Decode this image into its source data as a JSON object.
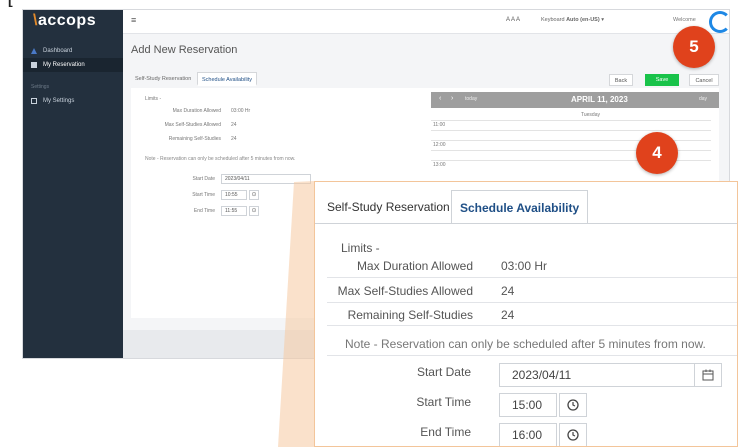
{
  "caption": "[",
  "app": {
    "logo": "accops",
    "topbar": {
      "menu_glyph": "≡",
      "font_controls": "A A A",
      "keyboard_label": "Keyboard",
      "keyboard_value": "Auto (en-US)",
      "keyboard_caret": "▾",
      "welcome": "Welcome"
    },
    "sidebar": {
      "items": [
        {
          "label": "Dashboard"
        },
        {
          "label": "My Reservation"
        }
      ],
      "section_label": "Settings",
      "settings_items": [
        {
          "label": "My Settings"
        }
      ]
    },
    "page_title": "Add New Reservation",
    "tabs": [
      "Self-Study Reservation",
      "Schedule Availability"
    ],
    "actions": {
      "back": "Back",
      "save": "Save",
      "cancel": "Cancel"
    },
    "form": {
      "limits_heading": "Limits -",
      "rows": [
        {
          "label": "Max Duration Allowed",
          "value": "03:00 Hr"
        },
        {
          "label": "Max Self-Studies Allowed",
          "value": "24"
        },
        {
          "label": "Remaining Self-Studies",
          "value": "24"
        }
      ],
      "note": "Note - Reservation can only be scheduled after 5 minutes from now.",
      "start_date_label": "Start Date",
      "start_date_value": "2023/04/11",
      "start_time_label": "Start Time",
      "start_time_value": "10:55",
      "end_time_label": "End Time",
      "end_time_value": "11:55"
    },
    "calendar": {
      "prev": "‹",
      "next": "›",
      "today": "today",
      "date": "APRIL 11, 2023",
      "view": "day",
      "weekday": "Tuesday",
      "slots": [
        "11:00",
        "",
        "12:00",
        "",
        "13:00"
      ]
    }
  },
  "zoom": {
    "tabs": [
      "Self-Study Reservation",
      "Schedule Availability"
    ],
    "limits_heading": "Limits -",
    "rows": [
      {
        "label": "Max Duration Allowed",
        "value": "03:00 Hr"
      },
      {
        "label": "Max Self-Studies Allowed",
        "value": "24"
      },
      {
        "label": "Remaining Self-Studies",
        "value": "24"
      }
    ],
    "note": "Note - Reservation can only be scheduled after 5 minutes from now.",
    "start_date_label": "Start Date",
    "start_date_value": "2023/04/11",
    "start_time_label": "Start Time",
    "start_time_value": "15:00",
    "end_time_label": "End Time",
    "end_time_value": "16:00"
  },
  "badges": {
    "save_step": "5",
    "tab_step": "4"
  },
  "colors": {
    "sidebar": "#23303e",
    "save_green": "#19c34a",
    "badge_red": "#e0421c",
    "active_tab": "#1f4f86",
    "callout_beam": "#f5c9a0"
  }
}
